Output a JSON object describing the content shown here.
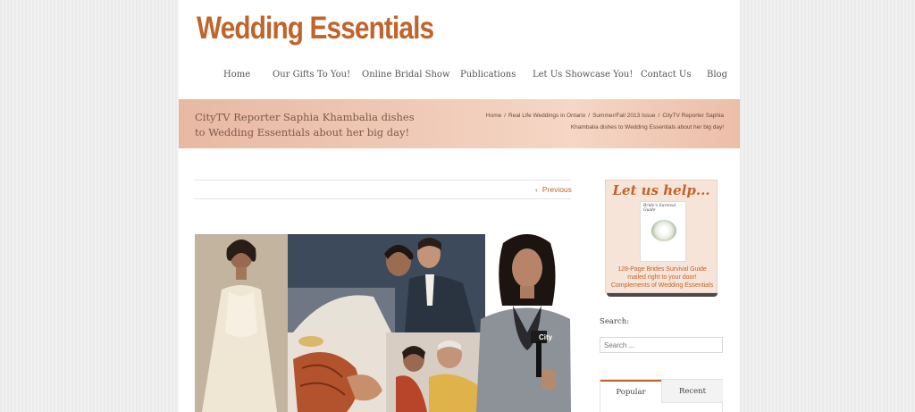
{
  "site": {
    "logo": "Wedding Essentials"
  },
  "nav": {
    "items": [
      {
        "label": "Home"
      },
      {
        "label": "Our Gifts To You!"
      },
      {
        "label": "Online Bridal Show"
      },
      {
        "label": "Publications"
      },
      {
        "label": "Let Us Showcase You!"
      },
      {
        "label": "Contact Us"
      },
      {
        "label": "Blog"
      }
    ]
  },
  "banner": {
    "title": "CityTV Reporter Saphia Khambalia dishes to Wedding Essentials about her big day!",
    "breadcrumb": [
      "Home",
      "Real Life Weddings in Ontario",
      "Summer/Fall 2013 Issue",
      "CityTV Reporter Saphia Khambalia dishes to Wedding Essentials about her big day!"
    ],
    "breadcrumb_sep": "/"
  },
  "post": {
    "prev_label": "Previous",
    "prev_chevron": "‹"
  },
  "photo": {
    "mic_label": "City"
  },
  "sidebar": {
    "ad": {
      "heading": "Let us help...",
      "book_title": "Bride's Survival Guide",
      "line1": "128-Page Brides Survival Guide",
      "line2": "mailed right to your door!",
      "line3": "Complements of Wedding Essentials"
    },
    "search": {
      "label": "Search:",
      "placeholder": "Search ..."
    },
    "tabs": [
      {
        "label": "Popular"
      },
      {
        "label": "Recent"
      }
    ]
  },
  "colors": {
    "brand": "#c0642a",
    "banner": "#efc6b2"
  }
}
